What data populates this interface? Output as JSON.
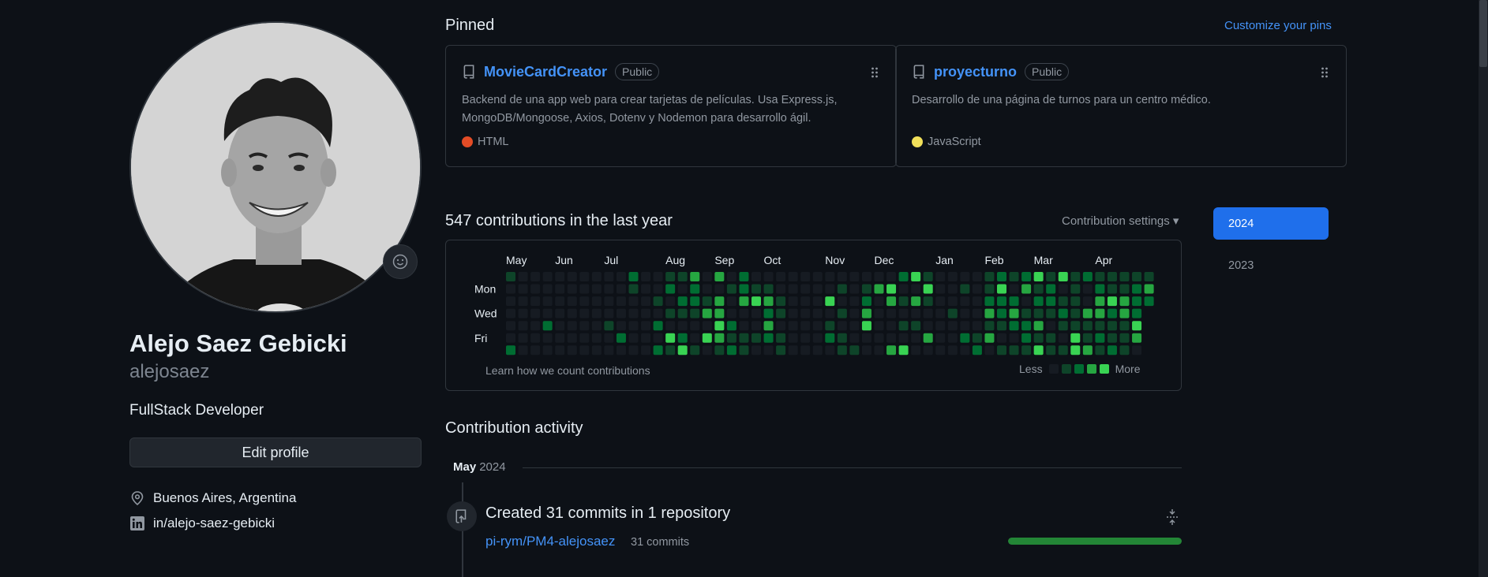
{
  "profile": {
    "fullname": "Alejo Saez Gebicki",
    "login": "alejosaez",
    "bio": "FullStack Developer",
    "edit_label": "Edit profile",
    "location": "Buenos Aires, Argentina",
    "linkedin": "in/alejo-saez-gebicki"
  },
  "pinned": {
    "title": "Pinned",
    "customize_label": "Customize your pins",
    "visibility": "Public",
    "repos": [
      {
        "name": "MovieCardCreator",
        "desc": "Backend de una app web para crear tarjetas de películas. Usa Express.js, MongoDB/Mongoose, Axios, Dotenv y Nodemon para desarrollo ágil.",
        "language": "HTML",
        "lang_color": "#e34c26"
      },
      {
        "name": "proyecturno",
        "desc": "Desarrollo de una página de turnos para un centro médico.",
        "language": "JavaScript",
        "lang_color": "#f1e05a"
      }
    ]
  },
  "contributions": {
    "title": "547 contributions in the last year",
    "settings_label": "Contribution settings",
    "months": [
      "May",
      "Jun",
      "Jul",
      "Aug",
      "Sep",
      "Oct",
      "Nov",
      "Dec",
      "Jan",
      "Feb",
      "Mar",
      "Apr"
    ],
    "days": [
      "Mon",
      "Wed",
      "Fri"
    ],
    "learn_label": "Learn how we count contributions",
    "less_label": "Less",
    "more_label": "More",
    "level_colors": [
      "#161b22",
      "#0e4429",
      "#006d32",
      "#26a641",
      "#39d353"
    ]
  },
  "years": {
    "active": "2024",
    "other": "2023",
    "accent": "#1f6feb"
  },
  "activity": {
    "title": "Contribution activity",
    "month": "May",
    "year": "2024",
    "event_title": "Created 31 commits in 1 repository",
    "repo": "pi-rym/PM4-alejosaez",
    "commits": "31 commits",
    "progress": 1.0
  }
}
